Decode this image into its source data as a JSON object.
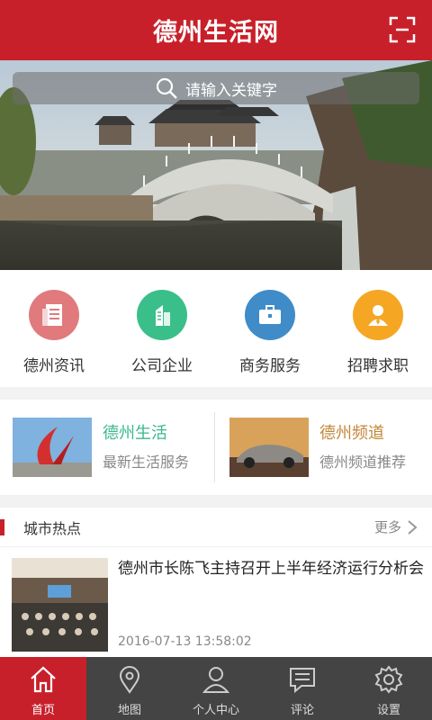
{
  "app": {
    "title": "德州生活网"
  },
  "search": {
    "placeholder": "请输入关键字"
  },
  "categories": [
    {
      "label": "德州资讯",
      "color": "#e07a7c",
      "icon": "news-icon"
    },
    {
      "label": "公司企业",
      "color": "#3bbf8a",
      "icon": "building-icon"
    },
    {
      "label": "商务服务",
      "color": "#3f8cc8",
      "icon": "briefcase-icon"
    },
    {
      "label": "招聘求职",
      "color": "#f5a623",
      "icon": "person-icon"
    }
  ],
  "promos": [
    {
      "title": "德州生活",
      "subtitle": "最新生活服务",
      "color": "#3bb98a"
    },
    {
      "title": "德州频道",
      "subtitle": "德州频道推荐",
      "color": "#c2873a"
    }
  ],
  "city_hot": {
    "heading": "城市热点",
    "more": "更多",
    "items": [
      {
        "title": "德州市长陈飞主持召开上半年经济运行分析会",
        "time": "2016-07-13 13:58:02"
      }
    ]
  },
  "tabs": [
    {
      "label": "首页",
      "icon": "home-icon",
      "active": true
    },
    {
      "label": "地图",
      "icon": "map-pin-icon",
      "active": false
    },
    {
      "label": "个人中心",
      "icon": "user-icon",
      "active": false
    },
    {
      "label": "评论",
      "icon": "comment-icon",
      "active": false
    },
    {
      "label": "设置",
      "icon": "gear-icon",
      "active": false
    }
  ],
  "colors": {
    "brand": "#c8202a",
    "tabbar": "#444444"
  }
}
